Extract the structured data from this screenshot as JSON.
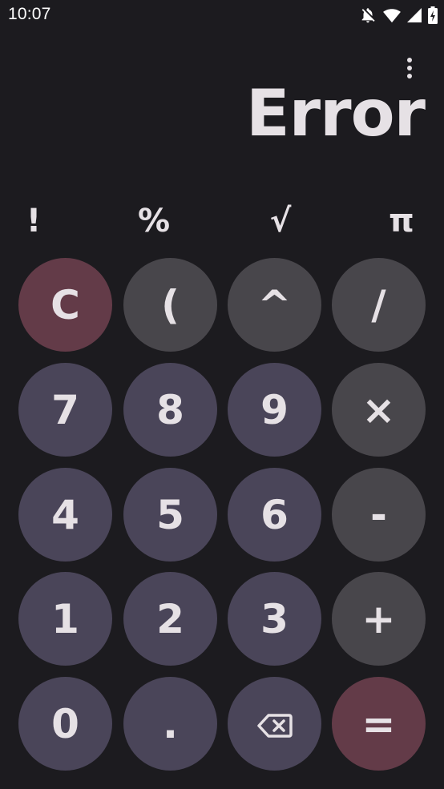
{
  "status_bar": {
    "time": "10:07",
    "icons": [
      "notifications-off-icon",
      "wifi-icon",
      "cellular-signal-icon",
      "battery-charging-icon"
    ]
  },
  "menu": {
    "icon": "more-vert-icon"
  },
  "display": {
    "value": "Error"
  },
  "scientific_keys": {
    "factorial": "!",
    "percent": "%",
    "sqrt": "√",
    "pi": "π"
  },
  "keys": {
    "clear": "C",
    "paren": "(",
    "power": "^",
    "divide": "/",
    "seven": "7",
    "eight": "8",
    "nine": "9",
    "multiply": "×",
    "four": "4",
    "five": "5",
    "six": "6",
    "minus": "-",
    "one": "1",
    "two": "2",
    "three": "3",
    "plus": "+",
    "zero": "0",
    "decimal": ".",
    "backspace": "backspace-icon",
    "equals": "="
  },
  "colors": {
    "background": "#1c1b1f",
    "number_key": "#4a4559",
    "operator_key": "#48464b",
    "accent_key": "#633b48",
    "text": "#e6e1e5"
  }
}
